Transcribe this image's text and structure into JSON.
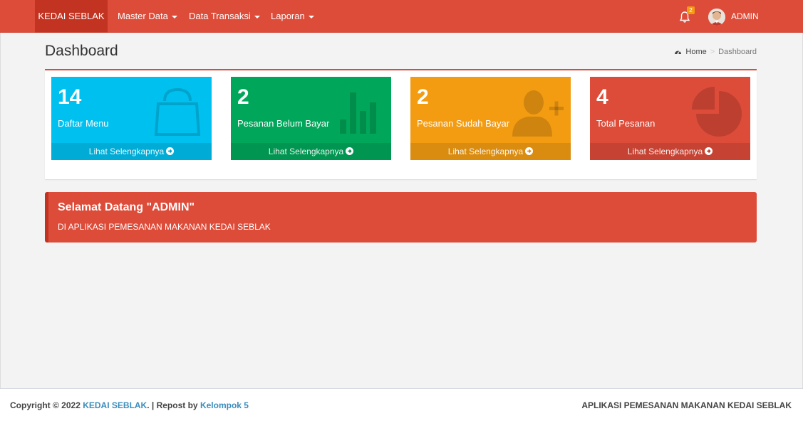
{
  "navbar": {
    "brand": "KEDAI SEBLAK",
    "menus": [
      {
        "label": "Master Data"
      },
      {
        "label": "Data Transaksi"
      },
      {
        "label": "Laporan"
      }
    ],
    "notification_count": "2",
    "user": "ADMIN"
  },
  "header": {
    "title": "Dashboard",
    "breadcrumb": {
      "home": "Home",
      "current": "Dashboard"
    }
  },
  "stats": [
    {
      "value": "14",
      "label": "Daftar Menu",
      "link": "Lihat Selengkapnya",
      "color": "#00c0ef",
      "icon": "shopping-bag-icon"
    },
    {
      "value": "2",
      "label": "Pesanan Belum Bayar",
      "link": "Lihat Selengkapnya",
      "color": "#00a65a",
      "icon": "bar-chart-icon"
    },
    {
      "value": "2",
      "label": "Pesanan Sudah Bayar",
      "link": "Lihat Selengkapnya",
      "color": "#f39c12",
      "icon": "user-plus-icon"
    },
    {
      "value": "4",
      "label": "Total Pesanan",
      "link": "Lihat Selengkapnya",
      "color": "#dd4b39",
      "icon": "pie-chart-icon"
    }
  ],
  "welcome": {
    "title": "Selamat Datang \"ADMIN\"",
    "subtitle": "DI APLIKASI PEMESANAN MAKANAN KEDAI SEBLAK"
  },
  "footer": {
    "copyright": "Copyright © 2022",
    "brand_link": "KEDAI SEBLAK",
    "repost": ". | Repost by",
    "author_link": "Kelompok 5",
    "right": "APLIKASI PEMESANAN MAKANAN KEDAI SEBLAK"
  },
  "colors": {
    "primary": "#dd4b39",
    "link": "#3c8dbc"
  }
}
